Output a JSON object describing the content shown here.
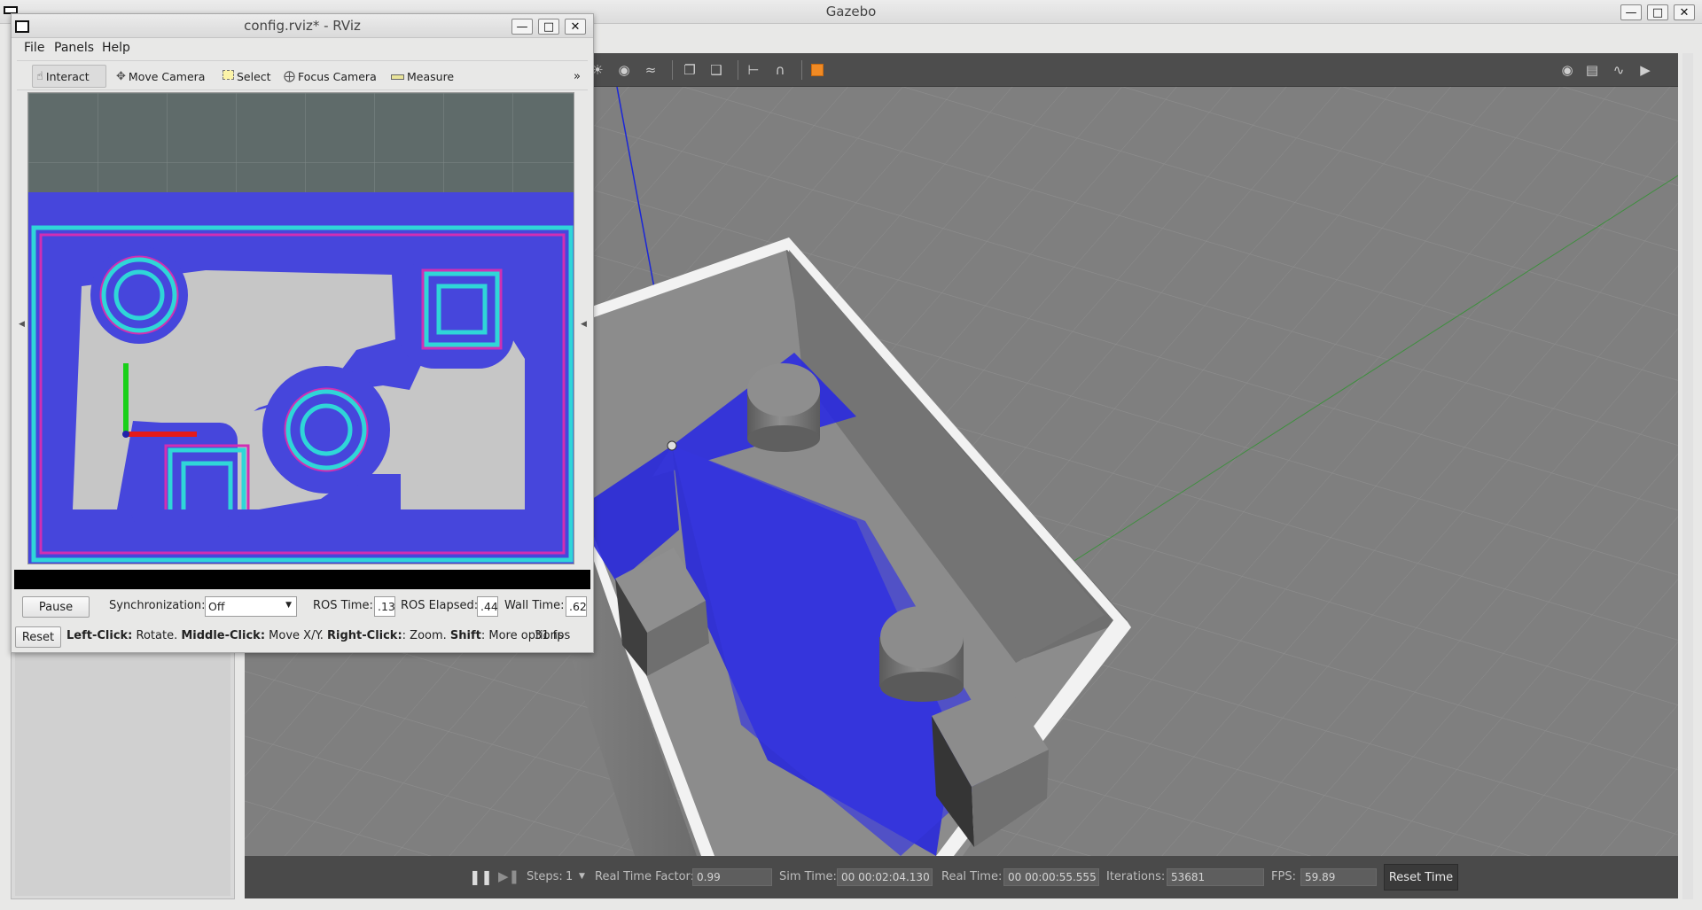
{
  "gazebo": {
    "title": "Gazebo",
    "status": {
      "steps_label": "Steps:",
      "steps_value": "1",
      "rtf_label": "Real Time Factor:",
      "rtf_value": "0.99",
      "sim_time_label": "Sim Time:",
      "sim_time_value": "00 00:02:04.130",
      "real_time_label": "Real Time:",
      "real_time_value": "00 00:00:55.555",
      "iterations_label": "Iterations:",
      "iterations_value": "53681",
      "fps_label": "FPS:",
      "fps_value": "59.89",
      "reset_time_label": "Reset Time"
    },
    "toolbar_icons": [
      "sun-light-icon",
      "point-light-icon",
      "spot-light-icon",
      "copy-icon",
      "paste-icon",
      "align-icon",
      "snap-magnet-icon",
      "color-box-icon",
      "screenshot-camera-icon",
      "log-icon",
      "plot-icon",
      "video-record-icon"
    ]
  },
  "rviz": {
    "title": "config.rviz* - RViz",
    "menu": {
      "file": "File",
      "panels": "Panels",
      "help": "Help"
    },
    "tools": {
      "interact": "Interact",
      "move_camera": "Move Camera",
      "select": "Select",
      "focus_camera": "Focus Camera",
      "measure": "Measure",
      "more": "»"
    },
    "time": {
      "pause_label": "Pause",
      "sync_label": "Synchronization:",
      "sync_value": "Off",
      "ros_time_label": "ROS Time:",
      "ros_time_value": ".13",
      "ros_elapsed_label": "ROS Elapsed:",
      "ros_elapsed_value": ".44",
      "wall_time_label": "Wall Time:",
      "wall_time_value": ".62"
    },
    "hints": {
      "reset_label": "Reset",
      "left_click": "Left-Click:",
      "rotate": " Rotate. ",
      "middle_click": "Middle-Click:",
      "move_xy": " Move X/Y. ",
      "right_click": "Right-Click:",
      "zoom": ": Zoom. ",
      "shift": "Shift",
      "more_options": ": More options",
      "fps": "31 fps"
    }
  }
}
